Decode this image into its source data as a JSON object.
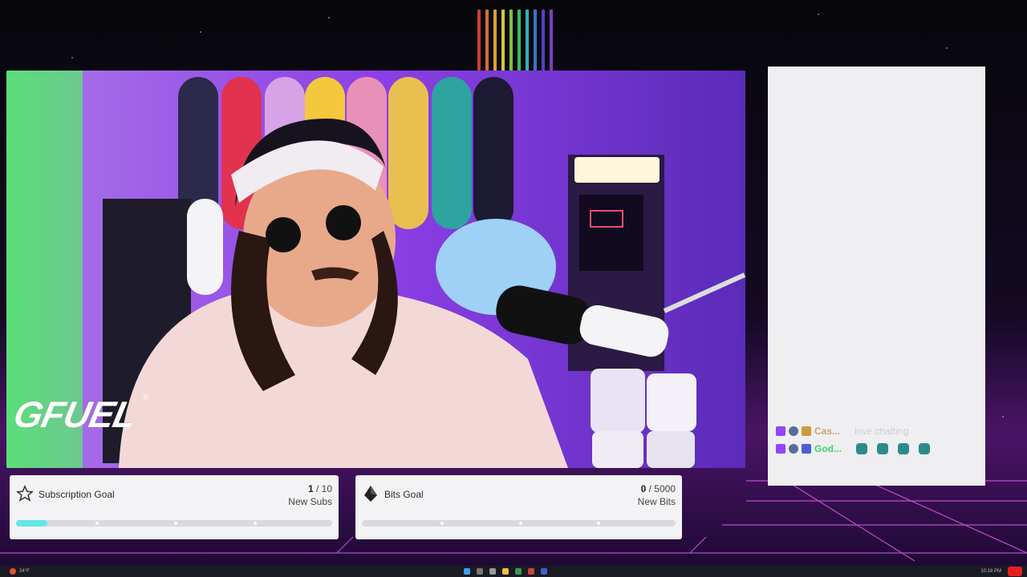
{
  "overlay": {
    "brand_logo": "GFUEL",
    "brand_mark": "®"
  },
  "subscription_goal": {
    "title": "Subscription Goal",
    "current": "1",
    "separator": " / ",
    "target": "10",
    "unit": "New Subs",
    "progress_fraction": 0.1,
    "icon": "star-icon"
  },
  "bits_goal": {
    "title": "Bits Goal",
    "current": "0",
    "separator": " / ",
    "target": "5000",
    "unit": "New Bits",
    "progress_fraction": 0.0,
    "icon": "bits-gem-icon"
  },
  "chat": {
    "messages": [
      {
        "user": "Cas...",
        "text": "love chatting",
        "user_color": "#c7a66c"
      },
      {
        "user": "God...",
        "text": "",
        "user_color": "#38d66a"
      }
    ]
  },
  "taskbar": {
    "weather": "24°F",
    "clock": "10:16 PM"
  },
  "colors": {
    "progress_fill": "#63e6e9",
    "goal_background": "#f3f3f5",
    "chat_background": "#efeef1",
    "scene_purple": "#8b3fe0"
  }
}
